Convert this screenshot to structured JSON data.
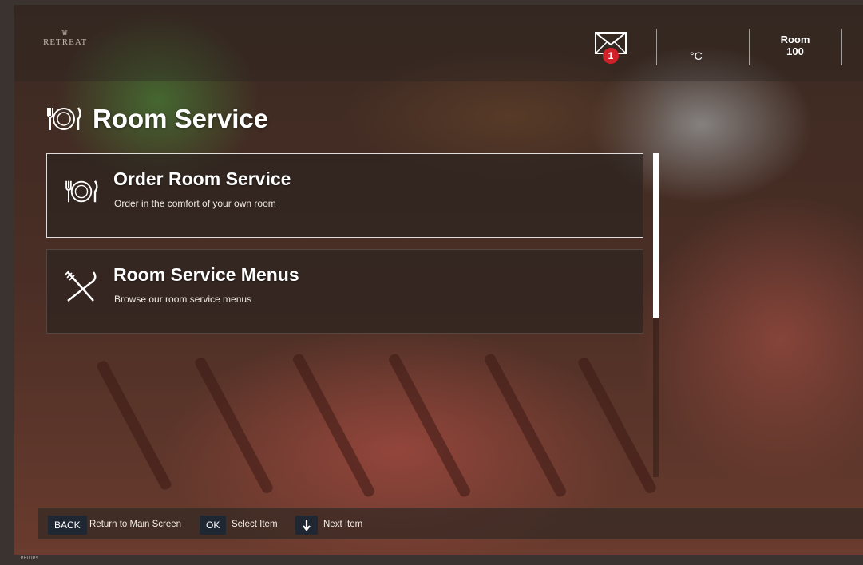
{
  "branding": {
    "logo_text": "RETREAT",
    "tv_brand": "PHILIPS"
  },
  "header": {
    "mail_icon": "envelope-icon",
    "mail_badge": "1",
    "temperature": "°C",
    "room_label": "Room",
    "room_number": "100"
  },
  "page": {
    "title": "Room Service",
    "title_icon": "plate-fork-knife-icon"
  },
  "menu": {
    "items": [
      {
        "label": "Order Room Service",
        "description": "Order in the comfort of your own room",
        "icon": "plate-fork-knife-icon",
        "selected": true
      },
      {
        "label": "Room Service Menus",
        "description": "Browse our room service menus",
        "icon": "crossed-cutlery-icon",
        "selected": false
      }
    ]
  },
  "footer": {
    "back_key": "BACK",
    "back_label": "Return to Main Screen",
    "ok_key": "OK",
    "ok_label": "Select Item",
    "down_key": "down-arrow-icon",
    "down_label": "Next Item"
  },
  "colors": {
    "badge": "#d0212b",
    "key_bg": "#1f2733"
  }
}
